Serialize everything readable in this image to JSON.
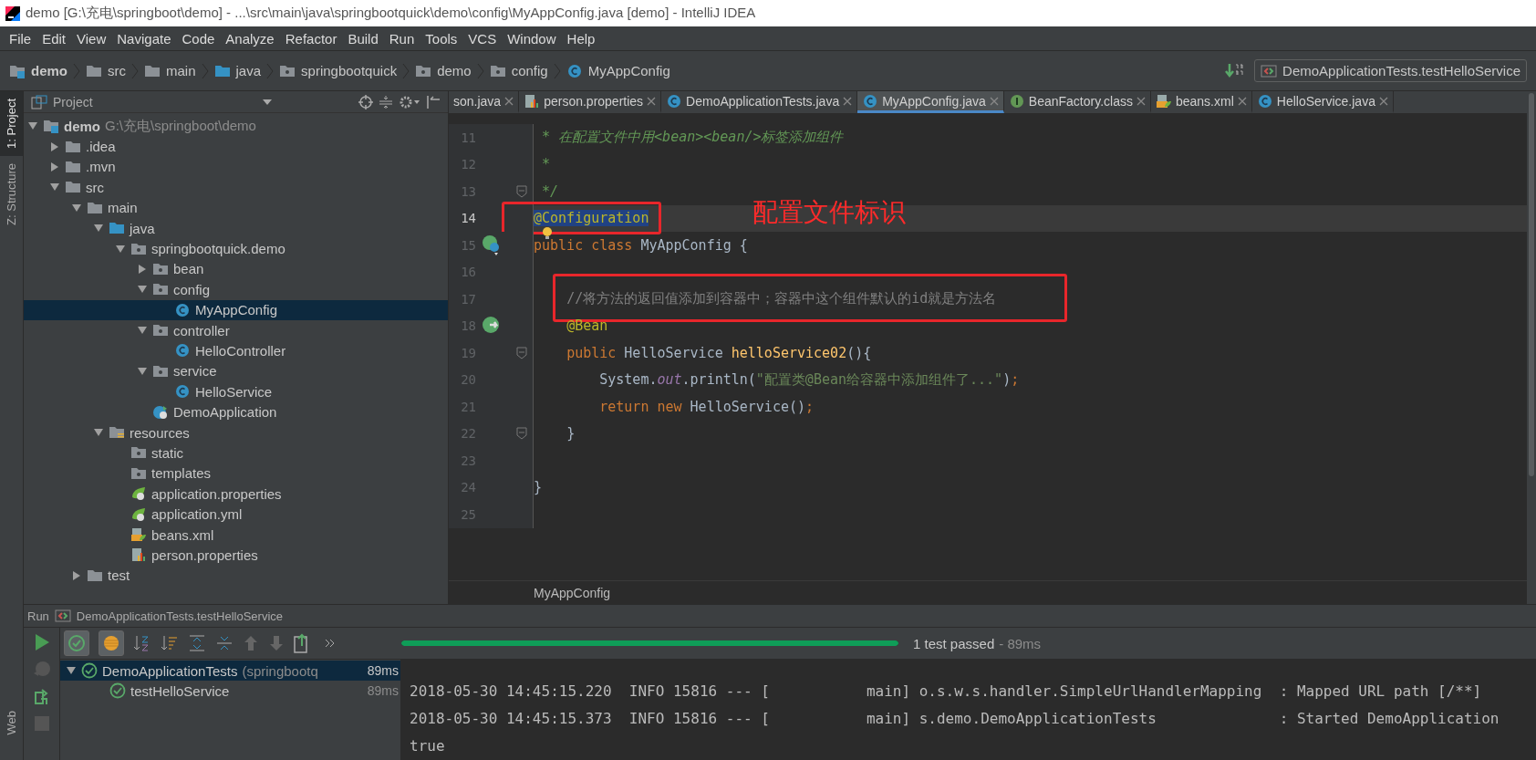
{
  "window": {
    "title": "demo [G:\\充电\\springboot\\demo] - ...\\src\\main\\java\\springbootquick\\demo\\config\\MyAppConfig.java [demo] - IntelliJ IDEA"
  },
  "menu": [
    "File",
    "Edit",
    "View",
    "Navigate",
    "Code",
    "Analyze",
    "Refactor",
    "Build",
    "Run",
    "Tools",
    "VCS",
    "Window",
    "Help"
  ],
  "breadcrumb": [
    {
      "label": "demo",
      "kind": "module"
    },
    {
      "label": "src",
      "kind": "folder"
    },
    {
      "label": "main",
      "kind": "folder"
    },
    {
      "label": "java",
      "kind": "source"
    },
    {
      "label": "springbootquick",
      "kind": "package"
    },
    {
      "label": "demo",
      "kind": "package"
    },
    {
      "label": "config",
      "kind": "package"
    },
    {
      "label": "MyAppConfig",
      "kind": "class"
    }
  ],
  "run_config": {
    "label": "DemoApplicationTests.testHelloService"
  },
  "left_tools_top": [
    {
      "label": "1: Project",
      "selected": true
    },
    {
      "label": "Z: Structure",
      "selected": false
    }
  ],
  "left_tools_bottom": [
    {
      "label": "Web"
    }
  ],
  "project_panel": {
    "title": "Project",
    "tree": [
      {
        "label": "demo",
        "hint": "G:\\充电\\springboot\\demo",
        "kind": "module",
        "expanded": true,
        "selected": false,
        "children": [
          {
            "label": ".idea",
            "kind": "folder",
            "expanded": false,
            "selected": false
          },
          {
            "label": ".mvn",
            "kind": "folder",
            "expanded": false,
            "selected": false
          },
          {
            "label": "src",
            "kind": "folder",
            "expanded": true,
            "selected": false,
            "children": [
              {
                "label": "main",
                "kind": "folder",
                "expanded": true,
                "selected": false,
                "children": [
                  {
                    "label": "java",
                    "kind": "source",
                    "expanded": true,
                    "selected": false,
                    "children": [
                      {
                        "label": "springbootquick.demo",
                        "kind": "package",
                        "expanded": true,
                        "selected": false,
                        "children": [
                          {
                            "label": "bean",
                            "kind": "package",
                            "expanded": false,
                            "selected": false
                          },
                          {
                            "label": "config",
                            "kind": "package",
                            "expanded": true,
                            "selected": false,
                            "children": [
                              {
                                "label": "MyAppConfig",
                                "kind": "class",
                                "selected": true
                              }
                            ]
                          },
                          {
                            "label": "controller",
                            "kind": "package",
                            "expanded": true,
                            "selected": false,
                            "children": [
                              {
                                "label": "HelloController",
                                "kind": "class",
                                "selected": false
                              }
                            ]
                          },
                          {
                            "label": "service",
                            "kind": "package",
                            "expanded": true,
                            "selected": false,
                            "children": [
                              {
                                "label": "HelloService",
                                "kind": "class",
                                "selected": false
                              }
                            ]
                          },
                          {
                            "label": "DemoApplication",
                            "kind": "app",
                            "selected": false
                          }
                        ]
                      }
                    ]
                  },
                  {
                    "label": "resources",
                    "kind": "resources",
                    "expanded": true,
                    "selected": false,
                    "children": [
                      {
                        "label": "static",
                        "kind": "package",
                        "selected": false
                      },
                      {
                        "label": "templates",
                        "kind": "package",
                        "selected": false
                      },
                      {
                        "label": "application.properties",
                        "kind": "config",
                        "selected": false
                      },
                      {
                        "label": "application.yml",
                        "kind": "config",
                        "selected": false
                      },
                      {
                        "label": "beans.xml",
                        "kind": "xml",
                        "selected": false
                      },
                      {
                        "label": "person.properties",
                        "kind": "properties",
                        "selected": false
                      }
                    ]
                  }
                ]
              },
              {
                "label": "test",
                "kind": "folder",
                "expanded": false,
                "selected": false
              }
            ]
          }
        ]
      }
    ]
  },
  "editor": {
    "tabs": [
      {
        "label": "son.java",
        "kind": "none",
        "selected": false
      },
      {
        "label": "person.properties",
        "kind": "properties",
        "selected": false
      },
      {
        "label": "DemoApplicationTests.java",
        "kind": "class",
        "selected": false
      },
      {
        "label": "MyAppConfig.java",
        "kind": "class",
        "selected": true
      },
      {
        "label": "BeanFactory.class",
        "kind": "interface",
        "selected": false
      },
      {
        "label": "beans.xml",
        "kind": "xml",
        "selected": false
      },
      {
        "label": "HelloService.java",
        "kind": "class",
        "selected": false
      }
    ],
    "lines": [
      {
        "number": "11",
        "current": false,
        "boxed": false,
        "tokens": [
          {
            "kind": "doc",
            "text": " * 在配置文件中用<bean><bean/>标签添加组件"
          }
        ]
      },
      {
        "number": "12",
        "current": false,
        "boxed": false,
        "tokens": [
          {
            "kind": "doc",
            "text": " *"
          }
        ]
      },
      {
        "number": "13",
        "current": false,
        "boxed": false,
        "marker": {
          "kind": "fold"
        },
        "tokens": [
          {
            "kind": "doc",
            "text": " */"
          }
        ]
      },
      {
        "number": "14",
        "current": true,
        "boxed": true,
        "note": "配置文件标识",
        "tokens": [
          {
            "kind": "selection",
            "text": "@Configuration"
          }
        ]
      },
      {
        "number": "15",
        "current": false,
        "boxed": false,
        "marker": {
          "kind": "bean-class"
        },
        "bulb": true,
        "tokens": [
          {
            "kind": "keyword",
            "text": "public class"
          },
          {
            "kind": "plain",
            "text": " MyAppConfig {"
          }
        ]
      },
      {
        "number": "16",
        "current": false,
        "boxed": false
      },
      {
        "number": "17",
        "current": false,
        "boxed": true,
        "tokens": [
          {
            "kind": "indent"
          },
          {
            "kind": "comment",
            "text": "//将方法的返回值添加到容器中；容器中这个组件默认的id就是方法名"
          }
        ]
      },
      {
        "number": "18",
        "current": false,
        "boxed": false,
        "marker": {
          "kind": "bean-method"
        },
        "tokens": [
          {
            "kind": "indent"
          },
          {
            "kind": "annotation",
            "text": "@Bean"
          }
        ]
      },
      {
        "number": "19",
        "current": false,
        "boxed": false,
        "marker": {
          "kind": "fold"
        },
        "tokens": [
          {
            "kind": "indent"
          },
          {
            "kind": "keyword",
            "text": "public"
          },
          {
            "kind": "plain",
            "text": " HelloService "
          },
          {
            "kind": "method",
            "text": "helloService02"
          },
          {
            "kind": "plain",
            "text": "(){"
          }
        ]
      },
      {
        "number": "20",
        "current": false,
        "boxed": false,
        "tokens": [
          {
            "kind": "indent"
          },
          {
            "kind": "indent"
          },
          {
            "kind": "plain",
            "text": "System."
          },
          {
            "kind": "static",
            "text": "out"
          },
          {
            "kind": "plain",
            "text": ".println("
          },
          {
            "kind": "string",
            "text": "\"配置类@Bean给容器中添加组件了...\""
          },
          {
            "kind": "plain",
            "text": ")"
          },
          {
            "kind": "keyword",
            "text": ";"
          }
        ]
      },
      {
        "number": "21",
        "current": false,
        "boxed": false,
        "tokens": [
          {
            "kind": "indent"
          },
          {
            "kind": "indent"
          },
          {
            "kind": "keyword",
            "text": "return new"
          },
          {
            "kind": "plain",
            "text": " HelloService()"
          },
          {
            "kind": "keyword",
            "text": ";"
          }
        ]
      },
      {
        "number": "22",
        "current": false,
        "boxed": false,
        "marker": {
          "kind": "fold"
        },
        "tokens": [
          {
            "kind": "indent"
          },
          {
            "kind": "plain",
            "text": "}"
          }
        ]
      },
      {
        "number": "23",
        "current": false,
        "boxed": false
      },
      {
        "number": "24",
        "current": false,
        "boxed": false,
        "tokens": [
          {
            "kind": "plain",
            "text": "}"
          }
        ]
      },
      {
        "number": "25",
        "current": false,
        "boxed": false
      }
    ],
    "footer": "MyAppConfig"
  },
  "run_panel": {
    "title": "Run",
    "config": "DemoApplicationTests.testHelloService",
    "toggles": [
      {
        "kind": "passed",
        "on": true
      },
      {
        "kind": "ignored",
        "on": true
      }
    ],
    "progress": {
      "level": 1,
      "status": "1 test passed",
      "duration": "- 89ms"
    },
    "tests": [
      {
        "label": "DemoApplicationTests",
        "hint": "(springbootq",
        "time": "89ms",
        "expanded": true,
        "selected": true,
        "children": [
          {
            "label": "testHelloService",
            "time": "89ms",
            "selected": false
          }
        ]
      }
    ],
    "console": [
      "2018-05-30 14:45:15.220  INFO 15816 --- [           main] o.s.w.s.handler.SimpleUrlHandlerMapping  : Mapped URL path [/**]",
      "2018-05-30 14:45:15.373  INFO 15816 --- [           main] s.demo.DemoApplicationTests              : Started DemoApplication",
      "true"
    ]
  }
}
